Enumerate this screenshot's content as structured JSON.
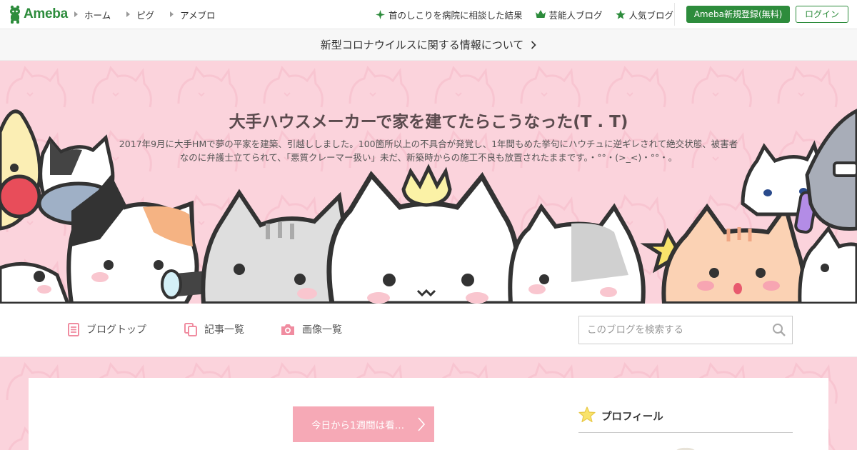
{
  "topnav": {
    "logo_text": "Ameba",
    "left_links": [
      "ホーム",
      "ピグ",
      "アメブロ"
    ],
    "right_links": [
      {
        "icon": "sparkle-icon",
        "label": "首のしこりを病院に相談した結果"
      },
      {
        "icon": "crown-icon",
        "label": "芸能人ブログ"
      },
      {
        "icon": "star-icon",
        "label": "人気ブログ"
      }
    ],
    "register_label": "Ameba新規登録(無料)",
    "login_label": "ログイン"
  },
  "notice": {
    "text": "新型コロナウイルスに関する情報について"
  },
  "header": {
    "title": "大手ハウスメーカーで家を建てたらこうなった(T . T)",
    "description": "2017年9月に大手HMで夢の平家を建築、引越ししました。100箇所以上の不具合が発覚し、1年間もめた挙句にハウチュに逆ギレされて絶交状態、被害者なのに弁護士立てられて、「悪質クレーマー扱い」未だ、新築時からの施工不良も放置されたままです。・°°・(>_<)・°°・。"
  },
  "blognav": {
    "items": [
      {
        "icon": "document-icon",
        "label": "ブログトップ"
      },
      {
        "icon": "copy-icon",
        "label": "記事一覧"
      },
      {
        "icon": "camera-icon",
        "label": "画像一覧"
      }
    ],
    "search_placeholder": "このブログを検索する"
  },
  "main": {
    "today_button": "今日から1週間は看…"
  },
  "sidebar": {
    "profile_heading": "プロフィール"
  },
  "colors": {
    "ameba_green": "#2d8c3c",
    "header_pink": "#fbd3dc",
    "accent_pink": "#f6a9b6"
  }
}
